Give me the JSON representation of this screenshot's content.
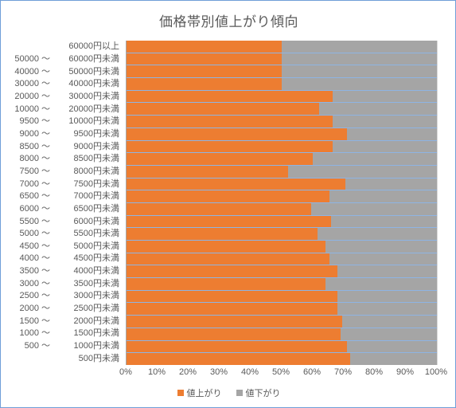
{
  "chart_data": {
    "type": "bar",
    "orientation": "horizontal",
    "stacked": true,
    "normalized": "percent",
    "title": "価格帯別値上がり傾向",
    "xlabel": "",
    "ylabel": "",
    "xlim": [
      0,
      100
    ],
    "grid": true,
    "legend_position": "bottom",
    "categories": [
      "60000円以上",
      "50000 ～ 60000円未満",
      "40000 ～ 50000円未満",
      "30000 ～ 40000円未満",
      "20000 ～ 30000円未満",
      "10000 ～ 20000円未満",
      "9500 ～ 10000円未満",
      "9000 ～ 9500円未満",
      "8500 ～ 9000円未満",
      "8000 ～ 8500円未満",
      "7500 ～ 8000円未満",
      "7000 ～ 7500円未満",
      "6500 ～ 7000円未満",
      "6000 ～ 6500円未満",
      "5500 ～ 6000円未満",
      "5000 ～ 5500円未満",
      "4500 ～ 5000円未満",
      "4000 ～ 4500円未満",
      "3500 ～ 4000円未満",
      "3000 ～ 3500円未満",
      "2500 ～ 3000円未満",
      "2000 ～ 2500円未満",
      "1500 ～ 2000円未満",
      "1000 ～ 1500円未満",
      "500 ～ 1000円未満",
      "500円未満"
    ],
    "category_parts": [
      {
        "from": "",
        "to": "60000円以上"
      },
      {
        "from": "50000 ～",
        "to": "60000円未満"
      },
      {
        "from": "40000 ～",
        "to": "50000円未満"
      },
      {
        "from": "30000 ～",
        "to": "40000円未満"
      },
      {
        "from": "20000 ～",
        "to": "30000円未満"
      },
      {
        "from": "10000 ～",
        "to": "20000円未満"
      },
      {
        "from": "9500 ～",
        "to": "10000円未満"
      },
      {
        "from": "9000 ～",
        "to": "9500円未満"
      },
      {
        "from": "8500 ～",
        "to": "9000円未満"
      },
      {
        "from": "8000 ～",
        "to": "8500円未満"
      },
      {
        "from": "7500 ～",
        "to": "8000円未満"
      },
      {
        "from": "7000 ～",
        "to": "7500円未満"
      },
      {
        "from": "6500 ～",
        "to": "7000円未満"
      },
      {
        "from": "6000 ～",
        "to": "6500円未満"
      },
      {
        "from": "5500 ～",
        "to": "6000円未満"
      },
      {
        "from": "5000 ～",
        "to": "5500円未満"
      },
      {
        "from": "4500 ～",
        "to": "5000円未満"
      },
      {
        "from": "4000 ～",
        "to": "4500円未満"
      },
      {
        "from": "3500 ～",
        "to": "4000円未満"
      },
      {
        "from": "3000 ～",
        "to": "3500円未満"
      },
      {
        "from": "2500 ～",
        "to": "3000円未満"
      },
      {
        "from": "2000 ～",
        "to": "2500円未満"
      },
      {
        "from": "1500 ～",
        "to": "2000円未満"
      },
      {
        "from": "1000 ～",
        "to": "1500円未満"
      },
      {
        "from": "500 ～",
        "to": "1000円未満"
      },
      {
        "from": "",
        "to": "500円未満"
      }
    ],
    "series": [
      {
        "name": "値上がり",
        "color": "#ED7D31",
        "values": [
          50,
          50,
          50,
          50,
          66.5,
          62,
          66.5,
          71,
          66.5,
          60,
          52,
          70.5,
          65.5,
          59.5,
          66,
          61.5,
          64,
          65.5,
          68,
          64,
          68,
          68,
          69.5,
          69,
          71,
          72
        ]
      },
      {
        "name": "値下がり",
        "color": "#A5A5A5",
        "values": [
          50,
          50,
          50,
          50,
          33.5,
          38,
          33.5,
          29,
          33.5,
          40,
          48,
          29.5,
          34.5,
          40.5,
          34,
          38.5,
          36,
          34.5,
          32,
          36,
          32,
          32,
          30.5,
          31,
          29,
          28
        ]
      }
    ],
    "x_ticks": [
      "0%",
      "10%",
      "20%",
      "30%",
      "40%",
      "50%",
      "60%",
      "70%",
      "80%",
      "90%",
      "100%"
    ],
    "x_tick_values": [
      0,
      10,
      20,
      30,
      40,
      50,
      60,
      70,
      80,
      90,
      100
    ]
  },
  "colors": {
    "up": "#ED7D31",
    "down": "#A5A5A5",
    "title": "#595959",
    "gridline": "#8EB4E3",
    "frame": "#6F9ED8"
  }
}
